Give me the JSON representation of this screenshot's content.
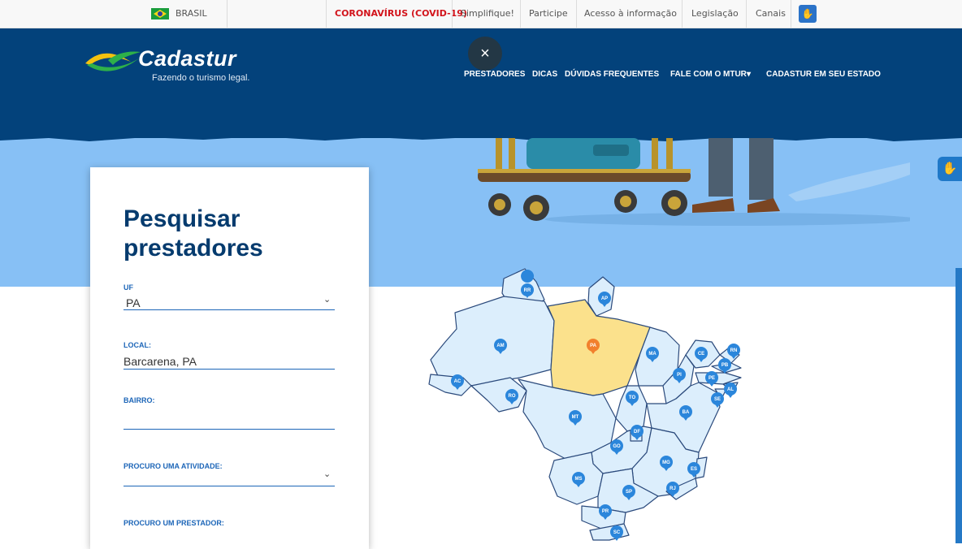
{
  "gov_bar": {
    "country": "BRASIL",
    "covid_link": "CORONAVÍRUS (COVID-19)",
    "links": [
      "Simplifique!",
      "Participe",
      "Acesso à informação",
      "Legislação",
      "Canais"
    ],
    "covid_color": "#d2131b"
  },
  "header": {
    "logo_name": "Cadastur",
    "logo_tagline": "Fazendo o turismo legal.",
    "close_icon": "×",
    "nav": [
      "PRESTADORES",
      "DICAS",
      "DÚVIDAS FREQUENTES",
      "FALE COM O MTUR",
      "CADASTUR EM SEU ESTADO"
    ],
    "nav_dropdown_arrow": "▾",
    "background": "#03427b"
  },
  "search_card": {
    "title": "Pesquisar prestadores",
    "uf_label": "UF",
    "uf_value": "PA",
    "local_label": "LOCAL:",
    "local_value": "Barcarena, PA",
    "bairro_label": "BAIRRO:",
    "bairro_value": "",
    "atividade_label": "PROCURO UMA ATIVIDADE:",
    "atividade_value": "",
    "prestador_label": "PROCURO UM PRESTADOR:",
    "chevron": "⌄"
  },
  "map": {
    "selected_state": "PA",
    "selected_color": "#fbe18c",
    "state_fill": "#dceefc",
    "pin_color": "#2b86db",
    "selected_pin_color": "#f2802d",
    "states": [
      "RR",
      "AP",
      "AM",
      "PA",
      "MA",
      "CE",
      "RN",
      "PB",
      "PE",
      "AL",
      "SE",
      "PI",
      "AC",
      "RO",
      "TO",
      "BA",
      "MT",
      "DF",
      "GO",
      "MG",
      "ES",
      "MS",
      "SP",
      "RJ",
      "PR",
      "SC"
    ]
  }
}
